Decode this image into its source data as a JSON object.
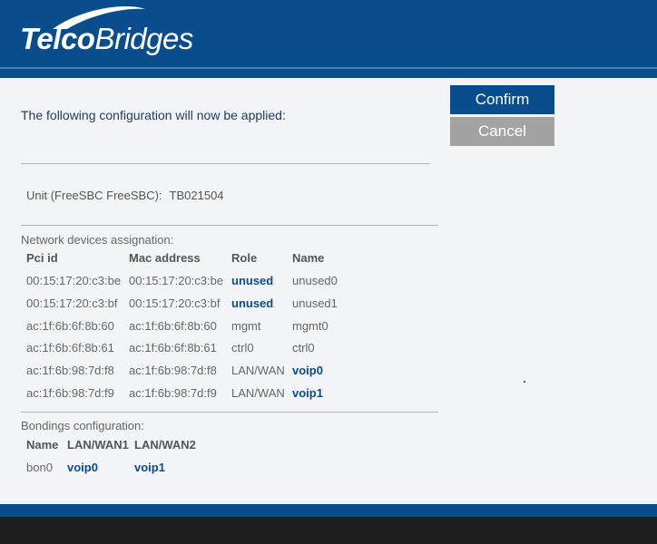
{
  "header": {
    "logo_bold": "Telco",
    "logo_light": "Bridges"
  },
  "actions": {
    "confirm_label": "Confirm",
    "cancel_label": "Cancel"
  },
  "intro_text": "The following configuration will now be applied:",
  "unit": {
    "label": "Unit (FreeSBC FreeSBC):",
    "value": "TB021504"
  },
  "network": {
    "title": "Network devices assignation:",
    "columns": [
      "Pci id",
      "Mac address",
      "Role",
      "Name"
    ],
    "rows": [
      {
        "pci": "00:15:17:20:c3:be",
        "mac": "00:15:17:20:c3:be",
        "role": "unused",
        "name": "unused0"
      },
      {
        "pci": "00:15:17:20:c3:bf",
        "mac": "00:15:17:20:c3:bf",
        "role": "unused",
        "name": "unused1"
      },
      {
        "pci": "ac:1f:6b:6f:8b:60",
        "mac": "ac:1f:6b:6f:8b:60",
        "role": "mgmt",
        "name": "mgmt0"
      },
      {
        "pci": "ac:1f:6b:6f:8b:61",
        "mac": "ac:1f:6b:6f:8b:61",
        "role": "ctrl0",
        "name": "ctrl0"
      },
      {
        "pci": "ac:1f:6b:98:7d:f8",
        "mac": "ac:1f:6b:98:7d:f8",
        "role": "LAN/WAN",
        "name": "voip0"
      },
      {
        "pci": "ac:1f:6b:98:7d:f9",
        "mac": "ac:1f:6b:98:7d:f9",
        "role": "LAN/WAN",
        "name": "voip1"
      }
    ]
  },
  "bondings": {
    "title": "Bondings configuration:",
    "columns": [
      "Name",
      "LAN/WAN1",
      "LAN/WAN2"
    ],
    "rows": [
      {
        "name": "bon0",
        "wan1": "voip0",
        "wan2": "voip1"
      }
    ]
  },
  "colors": {
    "brand_blue": "#0a4d8c",
    "cancel_gray": "#a3a3a3",
    "footer_dark": "#1e1e1e"
  }
}
